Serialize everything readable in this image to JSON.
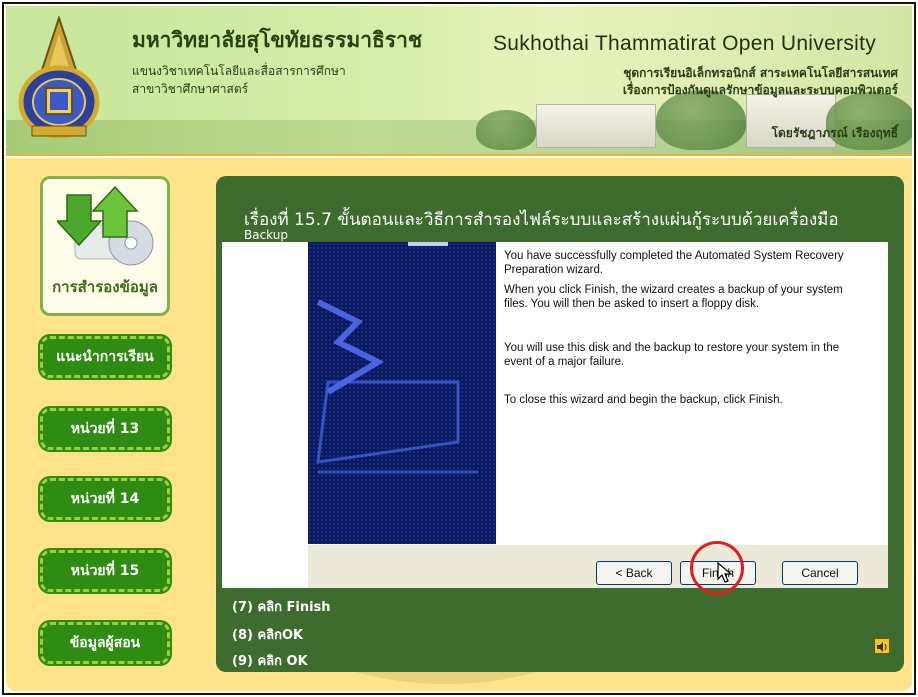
{
  "header": {
    "thai_title": "มหาวิทยาลัยสุโขทัยธรรมาธิราช",
    "thai_sub1": "แขนงวิชาเทคโนโลยีและสื่อสารการศึกษา",
    "thai_sub2": "สาขาวิชาศึกษาศาสตร์",
    "english_title": "Sukhothai  Thammatirat  Open  University",
    "right_line1": "ชุดการเรียนอิเล็กทรอนิกส์ สาระเทคโนโลยีสารสนเทศ",
    "right_line2": "เรื่องการป้องกันดูแลรักษาข้อมูลและระบบคอมพิวเตอร์",
    "author": "โดยรัชฎาภรณ์ เรืองฤทธิ์"
  },
  "sidebar": {
    "logo_label": "การสำรองข้อมูล",
    "items": [
      {
        "label": "แนะนำการเรียน"
      },
      {
        "label": "หน่วยที่ 13"
      },
      {
        "label": "หน่วยที่ 14"
      },
      {
        "label": "หน่วยที่ 15"
      },
      {
        "label": "ข้อมูลผู้สอน"
      }
    ]
  },
  "content": {
    "title": "เรื่องที่ 15.7 ขั้นตอนและวิธีการสำรองไฟล์ระบบและสร้างแผ่นกู้ระบบด้วยเครื่องมือ",
    "title_line2": "Backup",
    "wizard": {
      "para1": "You have successfully completed the Automated System Recovery Preparation wizard.",
      "para2": "When you click Finish, the wizard creates a backup of your system files. You will then be asked to insert a floppy disk.",
      "para3": "You will use this disk and the backup to restore your system in the event of a major failure.",
      "para4": "To close this wizard and begin the backup, click Finish.",
      "back_label": "< Back",
      "finish_label": "Finish",
      "cancel_label": "Cancel"
    },
    "steps": [
      "(7) คลิก Finish",
      "(8) คลิกOK",
      "(9) คลิก OK"
    ]
  },
  "colors": {
    "header_green": "#c7e69a",
    "panel_green": "#3e6b2e",
    "menu_green": "#2f8c12",
    "yellow_bg": "#ffe388",
    "wizard_blue": "#0b1a5e",
    "click_marker": "#e21c1c"
  }
}
